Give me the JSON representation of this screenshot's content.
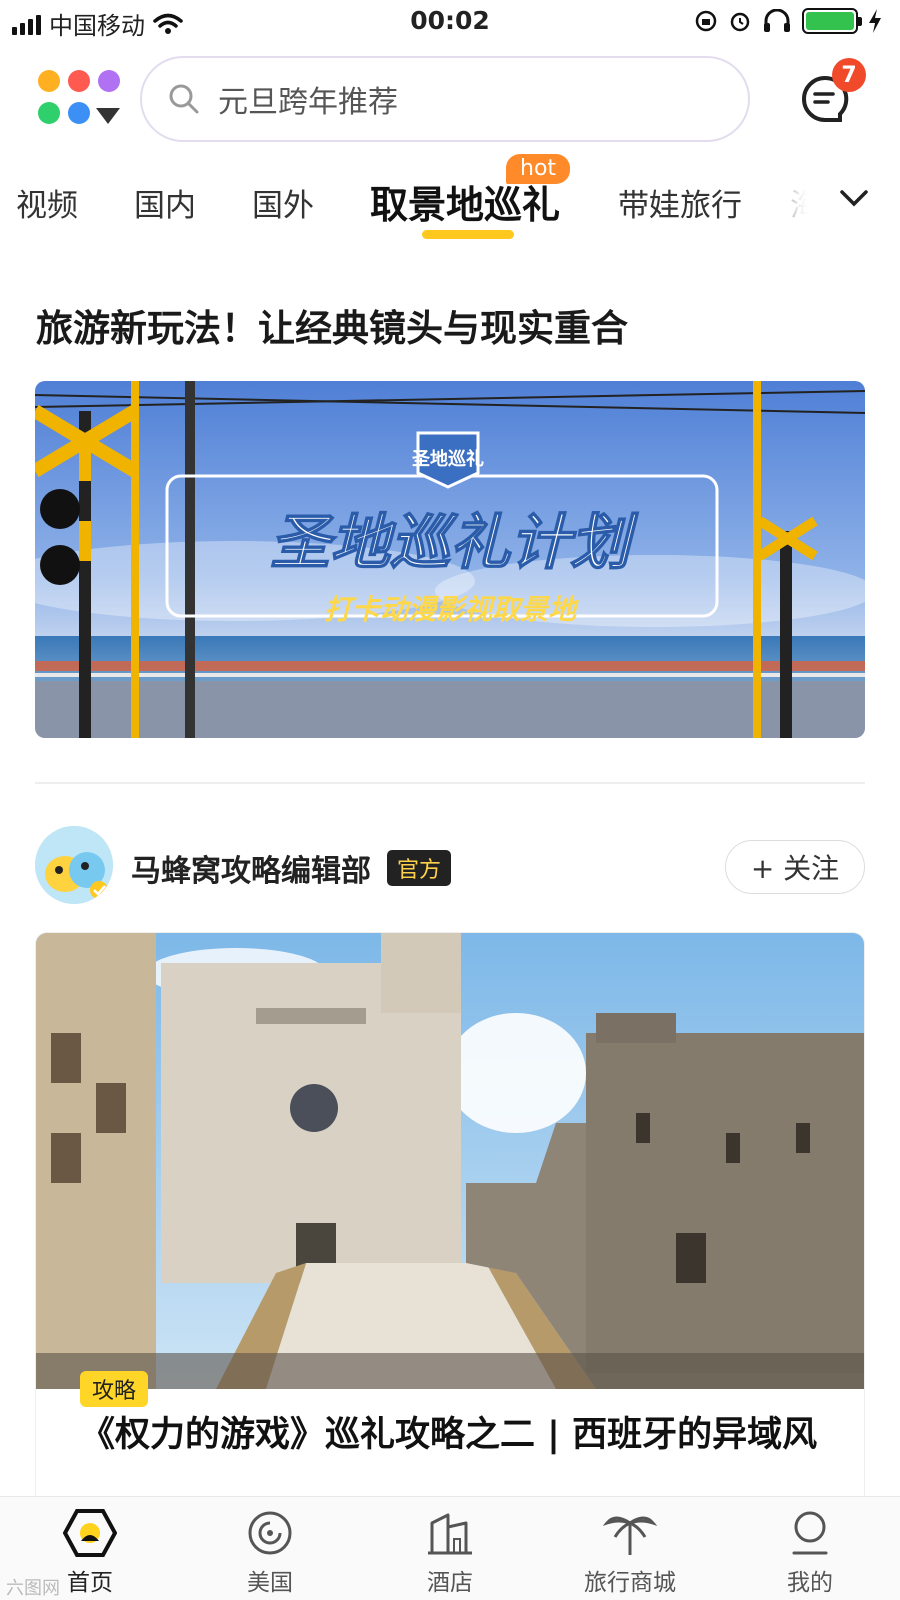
{
  "status_bar": {
    "carrier": "中国移动",
    "time": "00:02"
  },
  "search": {
    "placeholder": "元旦跨年推荐"
  },
  "messages": {
    "badge": "7"
  },
  "tabs": [
    {
      "label": "视频"
    },
    {
      "label": "国内"
    },
    {
      "label": "国外"
    },
    {
      "label": "取景地巡礼",
      "active": true,
      "badge": "hot"
    },
    {
      "label": "带娃旅行"
    },
    {
      "label": "海"
    }
  ],
  "section": {
    "title": "旅游新玩法！让经典镜头与现实重合"
  },
  "banner": {
    "logo_text": "圣地巡礼",
    "title": "圣地巡礼计划",
    "subtitle": "打卡动漫影视取景地"
  },
  "author": {
    "name": "马蜂窝攻略编辑部",
    "badge": "官方",
    "follow_label": "+ 关注"
  },
  "card": {
    "tag": "攻略",
    "title": "《权力的游戏》巡礼攻略之二 | 西班牙的异域风"
  },
  "bottom_nav": [
    {
      "label": "首页",
      "icon": "home-icon",
      "active": true
    },
    {
      "label": "美国",
      "icon": "compass-icon"
    },
    {
      "label": "酒店",
      "icon": "hotel-icon"
    },
    {
      "label": "旅行商城",
      "icon": "palm-tree-icon"
    },
    {
      "label": "我的",
      "icon": "profile-icon"
    }
  ],
  "watermark": "六图网",
  "colors": {
    "accent": "#ffc81e",
    "badge_red": "#f04a2b",
    "hot_orange": "#ff8a2a",
    "battery_green": "#33c24d"
  }
}
